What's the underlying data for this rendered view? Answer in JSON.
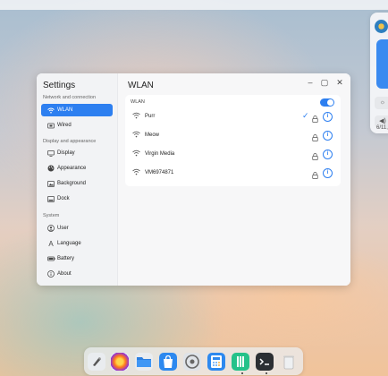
{
  "settings": {
    "title": "Settings",
    "sections": {
      "network": "Network and connection",
      "display": "Display and appearance",
      "system": "System"
    },
    "items": [
      {
        "label": "WLAN",
        "icon": "wifi-icon",
        "active": true
      },
      {
        "label": "Wired",
        "icon": "ethernet-icon"
      },
      {
        "label": "Display",
        "icon": "monitor-icon"
      },
      {
        "label": "Appearance",
        "icon": "palette-icon"
      },
      {
        "label": "Background",
        "icon": "image-icon"
      },
      {
        "label": "Dock",
        "icon": "dock-icon"
      },
      {
        "label": "User",
        "icon": "user-icon"
      },
      {
        "label": "Language",
        "icon": "language-icon"
      },
      {
        "label": "Battery",
        "icon": "battery-icon"
      },
      {
        "label": "About",
        "icon": "info-icon"
      }
    ]
  },
  "content": {
    "title": "WLAN",
    "card_header": "WLAN",
    "wlan_enabled": true,
    "networks": [
      {
        "name": "Purr",
        "connected": true
      },
      {
        "name": "Meow",
        "connected": false
      },
      {
        "name": "Virgin Media",
        "connected": false
      },
      {
        "name": "VM6974871",
        "connected": false
      }
    ]
  },
  "control_panel": {
    "date_partial": "6/11,"
  },
  "dock": {
    "apps": [
      "launcher-icon",
      "firefox-icon",
      "files-icon",
      "app-store-icon",
      "settings-icon",
      "calculator-icon",
      "textbook-icon",
      "terminal-icon",
      "trash-icon"
    ]
  },
  "colors": {
    "accent": "#2d7ff0"
  }
}
